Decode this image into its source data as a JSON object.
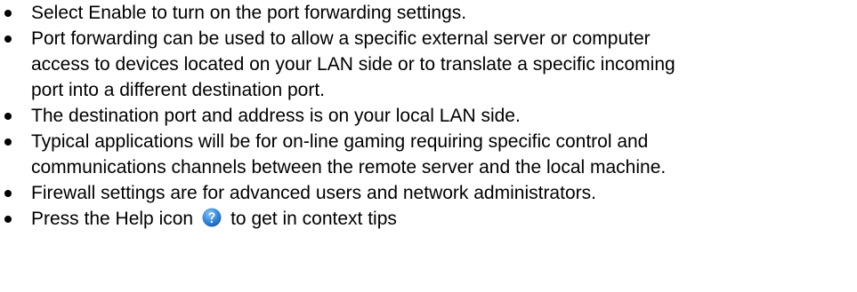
{
  "bullets": [
    {
      "lines": [
        "Select Enable to turn on the port forwarding settings."
      ]
    },
    {
      "lines": [
        "Port forwarding can be used to allow a specific external server or computer",
        "access to devices located on your LAN side or to translate a specific incoming",
        "port into a different destination port."
      ]
    },
    {
      "lines": [
        "The destination port and address is on your local LAN side."
      ]
    },
    {
      "lines": [
        "Typical applications will be for on-line gaming requiring specific control and",
        "communications channels between the remote server and the local machine."
      ]
    },
    {
      "lines": [
        "Firewall settings are for advanced users and network administrators."
      ]
    },
    {
      "before_icon": "Press the Help icon",
      "icon": "help-icon",
      "after_icon": "to get in context tips"
    }
  ],
  "colors": {
    "text": "#000000",
    "help_icon": "#2f7fd4"
  }
}
